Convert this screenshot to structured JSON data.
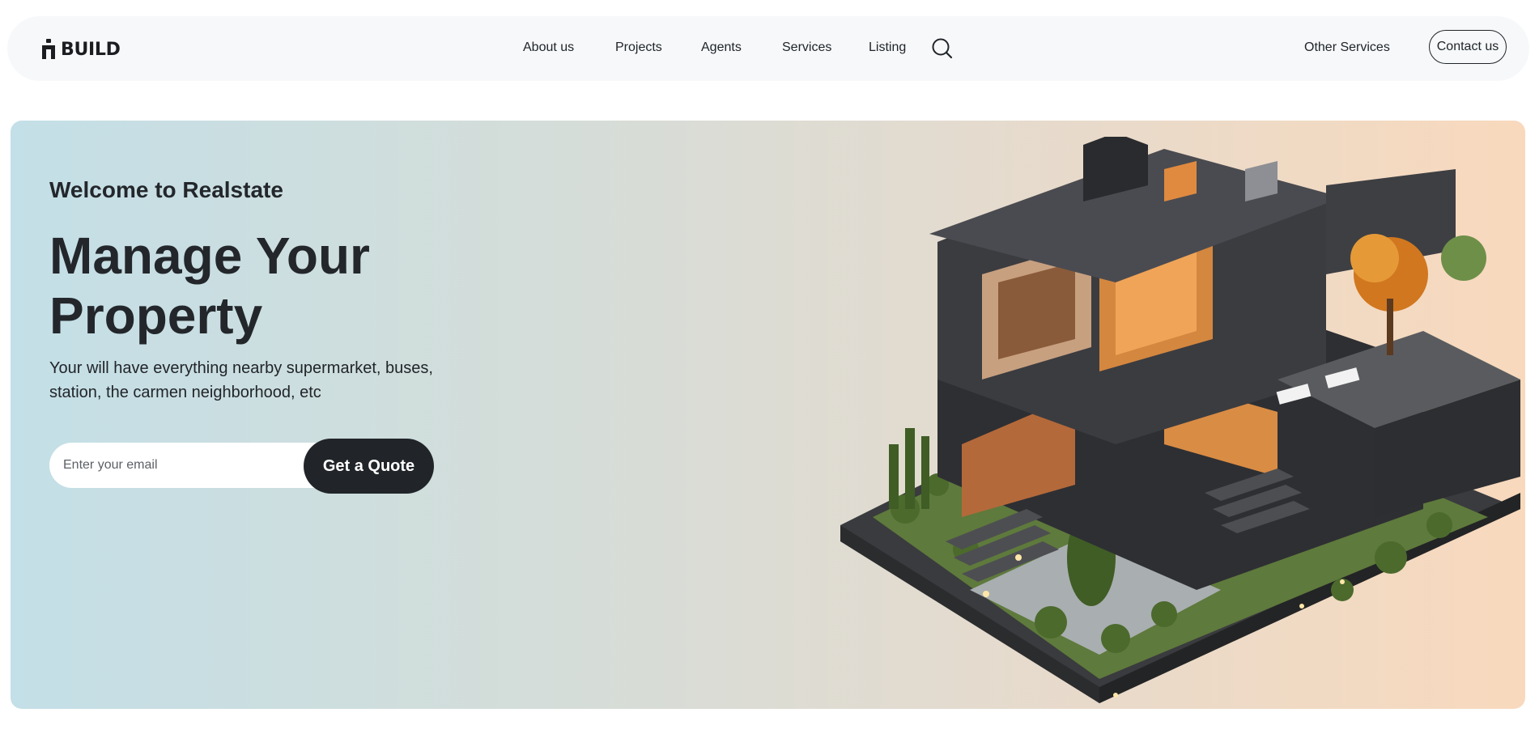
{
  "brand": {
    "name": "BUILD",
    "icon": "building-icon"
  },
  "nav": {
    "links": [
      "About us",
      "Projects",
      "Agents",
      "Services",
      "Listing"
    ],
    "search_icon": "search-icon",
    "other_services": "Other Services",
    "contact": "Contact us"
  },
  "hero": {
    "welcome": "Welcome to Realstate",
    "headline_line1": "Manage Your",
    "headline_line2": "Property",
    "subtext": "Your will have everything nearby supermarket, buses, station, the carmen neighborhood, etc",
    "email_placeholder": "Enter your email",
    "quote_button": "Get a Quote",
    "image": "modern-house-illustration"
  },
  "colors": {
    "dark": "#212529",
    "nav_bg": "#f6f8fa",
    "hero_gradient_start": "#c3dfe7",
    "hero_gradient_end": "#f8d9bd"
  }
}
